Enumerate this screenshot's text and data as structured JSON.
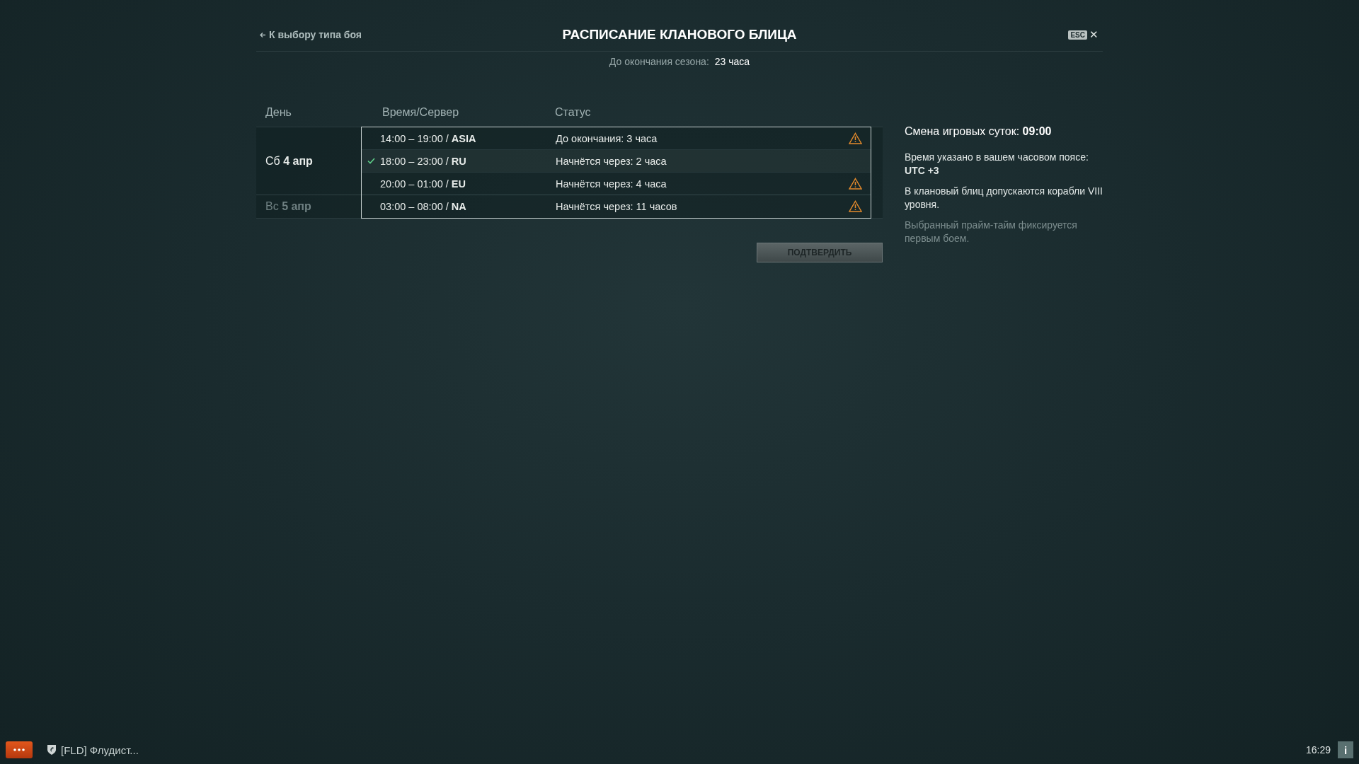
{
  "header": {
    "back_link": "К выбору типа боя",
    "title": "РАСПИСАНИЕ КЛАНОВОГО БЛИЦА",
    "esc_key": "ESC",
    "close": "✕"
  },
  "season": {
    "label": "До окончания сезона:",
    "value": "23 часа"
  },
  "table": {
    "columns": [
      "День",
      "Время/Сервер",
      "Статус"
    ],
    "days": [
      {
        "day": "Сб **4 апр**",
        "disabled": false,
        "slots": [
          {
            "time": "14:00 – 19:00 / **ASIA**",
            "status": "До окончания: 3 часа",
            "selected": false,
            "warning": true
          },
          {
            "time": "18:00 – 23:00 / **RU**",
            "status": "Начнётся через: 2 часа",
            "selected": true,
            "warning": false
          },
          {
            "time": "20:00 – 01:00 / **EU**",
            "status": "Начнётся через: 4 часа",
            "selected": false,
            "warning": true
          }
        ]
      },
      {
        "day": "Вс **5 апр**",
        "disabled": true,
        "slots": [
          {
            "time": "03:00 – 08:00 / **NA**",
            "status": "Начнётся через: 11 часов",
            "selected": false,
            "warning": true
          }
        ]
      }
    ]
  },
  "confirm_button": "ПОДТВЕРДИТЬ",
  "info": [
    {
      "text": "Смена игровых суток: **09:00**",
      "kind": "heading"
    },
    {
      "text": "Время указано в вашем часовом поясе: **UTC +3**",
      "kind": "normal"
    },
    {
      "text": "В клановый блиц допускаются корабли VIII уровня.",
      "kind": "normal"
    },
    {
      "text": "Выбранный прайм-тайм фиксируется первым боем.",
      "kind": "muted"
    }
  ],
  "footer": {
    "clan_chat": "[FLD] Флудист...",
    "clock": "16:29",
    "info_button": "i"
  }
}
